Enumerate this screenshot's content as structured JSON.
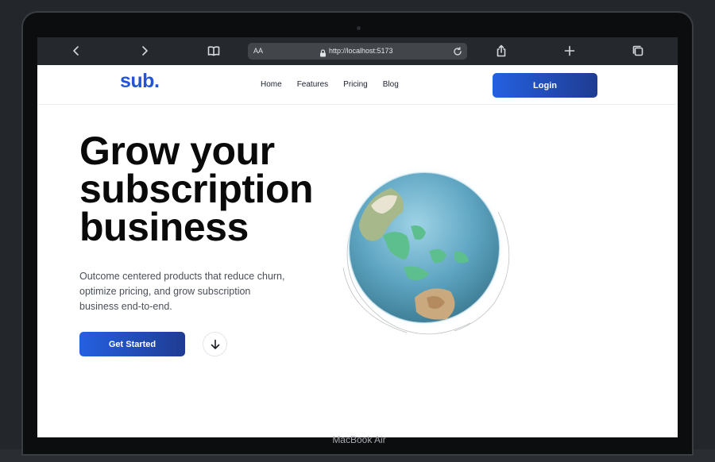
{
  "browser": {
    "url_aa": "AA",
    "url": "http://localhost:5173",
    "icons": [
      "back-icon",
      "forward-icon",
      "book-icon",
      "lock-icon",
      "reload-icon",
      "share-icon",
      "plus-icon",
      "tabs-icon"
    ]
  },
  "nav": {
    "logo": "sub.",
    "links": [
      "Home",
      "Features",
      "Pricing",
      "Blog"
    ],
    "login_label": "Login"
  },
  "hero": {
    "title": "Grow your subscription business",
    "subtitle": "Outcome centered products that reduce churn, optimize pricing, and grow subscription business end-to-end.",
    "cta_label": "Get Started",
    "scroll_icon": "arrow-down-icon"
  },
  "device": {
    "model_label": "MacBook Air"
  },
  "colors": {
    "accent": "#2460e0",
    "accent_dark": "#1f3c92",
    "logo": "#2356d6",
    "background": "#23272b"
  }
}
